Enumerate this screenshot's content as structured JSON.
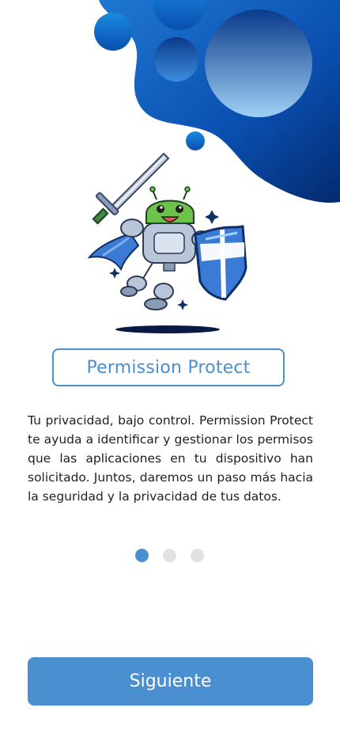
{
  "onboarding": {
    "title": "Permission Protect",
    "description": "Tu privacidad, bajo control. Permission Protect te ayuda a identificar y gestionar los permisos que las aplicaciones en tu dispositivo han solicitado. Juntos, daremos un paso más hacia la seguridad y la privacidad de tus datos.",
    "page_index": 1,
    "page_count": 3,
    "next_label": "Siguiente"
  },
  "hero": {
    "icon": "android-knight-shield-illustration"
  },
  "colors": {
    "accent": "#4a8fd0",
    "blob_dark": "#0a3a8a",
    "blob_mid": "#1f6fc2",
    "dot_inactive": "#e1e1e1",
    "text": "#1f1f1f"
  }
}
